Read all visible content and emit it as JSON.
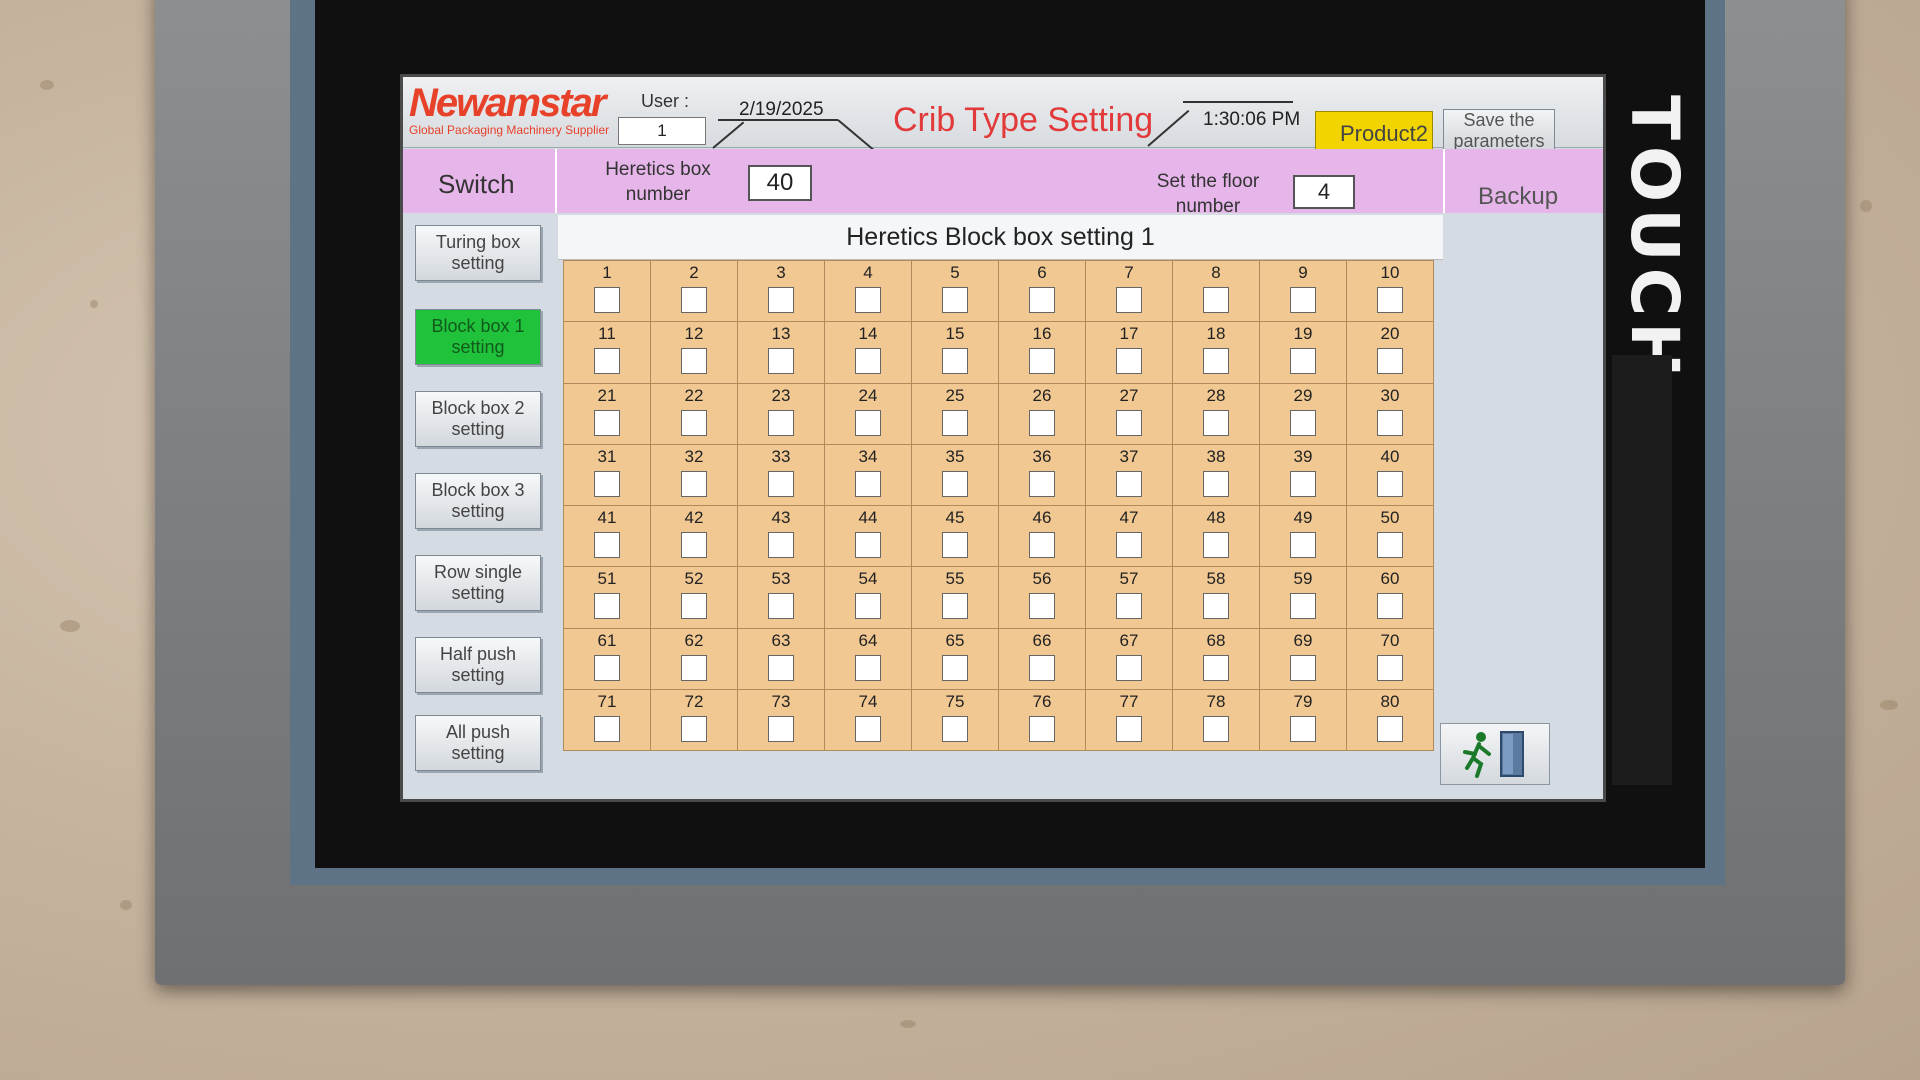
{
  "device": {
    "brand_vertical": "TOUCH"
  },
  "header": {
    "logo_main": "Newamstar",
    "logo_sub": "Global Packaging Machinery Supplier",
    "user_label": "User :",
    "user_value": "1",
    "date": "2/19/2025",
    "title": "Crib Type Setting",
    "time": "1:30:06 PM",
    "product_button": "Product2",
    "save_button": "Save the parameters"
  },
  "bar": {
    "switch_label": "Switch",
    "heretics_box_label": "Heretics box number",
    "heretics_box_value": "40",
    "floor_label": "Set the floor number",
    "floor_value": "4",
    "backup_label": "Backup"
  },
  "menu": [
    {
      "label": "Turing box setting",
      "active": false
    },
    {
      "label": "Block box 1 setting",
      "active": true
    },
    {
      "label": "Block box 2 setting",
      "active": false
    },
    {
      "label": "Block box 3 setting",
      "active": false
    },
    {
      "label": "Row single setting",
      "active": false
    },
    {
      "label": "Half push setting",
      "active": false
    },
    {
      "label": "All push setting",
      "active": false
    }
  ],
  "grid": {
    "title": "Heretics Block box setting 1",
    "cells": [
      "1",
      "2",
      "3",
      "4",
      "5",
      "6",
      "7",
      "8",
      "9",
      "10",
      "11",
      "12",
      "13",
      "14",
      "15",
      "16",
      "17",
      "18",
      "19",
      "20",
      "21",
      "22",
      "23",
      "24",
      "25",
      "26",
      "27",
      "28",
      "29",
      "30",
      "31",
      "32",
      "33",
      "34",
      "35",
      "36",
      "37",
      "38",
      "39",
      "40",
      "41",
      "42",
      "43",
      "44",
      "45",
      "46",
      "47",
      "48",
      "49",
      "50",
      "51",
      "52",
      "53",
      "54",
      "55",
      "56",
      "57",
      "58",
      "59",
      "60",
      "61",
      "62",
      "63",
      "64",
      "65",
      "66",
      "67",
      "68",
      "69",
      "70",
      "71",
      "72",
      "73",
      "74",
      "75",
      "76",
      "77",
      "78",
      "79",
      "80"
    ]
  },
  "colors": {
    "title_red": "#e23a3a",
    "pink_bar": "#e6b5ea",
    "grid_cell": "#f1c892",
    "active_button": "#1fc23a",
    "product_yellow": "#f1d400"
  },
  "icons": {
    "exit": "exit-door-icon"
  }
}
